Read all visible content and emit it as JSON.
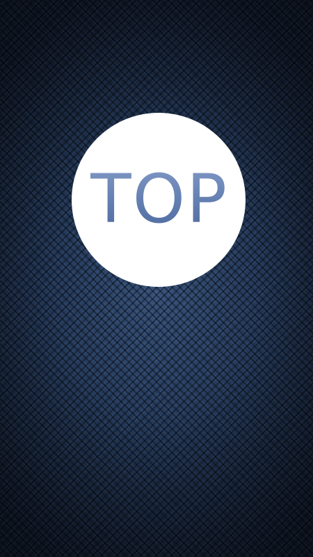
{
  "splash": {
    "logo_text": "TOP"
  },
  "colors": {
    "background_center": "#35507a",
    "background_edge": "#101a2d",
    "circle": "#ffffff",
    "logo_text": "#6580b2"
  }
}
